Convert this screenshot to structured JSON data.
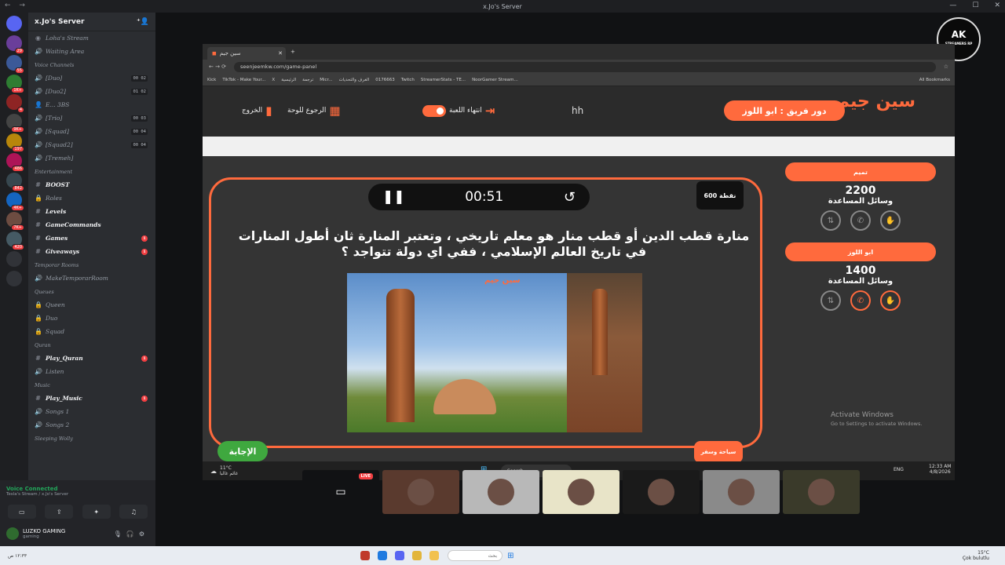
{
  "window": {
    "title": "x.Jo's Server"
  },
  "server": {
    "name": "x.Jo's Server",
    "sidebar_badges": [
      "29",
      "55",
      "1K+",
      "4",
      "9K+",
      "197",
      "486",
      "842",
      "4K+",
      "7K+",
      "420"
    ]
  },
  "channels": {
    "top": [
      {
        "icon": "stream",
        "label": "Loha's Stream"
      },
      {
        "icon": "speaker",
        "label": "Waiting Area"
      }
    ],
    "voice_category": "Voice Channels",
    "voice": [
      {
        "label": "[Duo]",
        "count": "00 02"
      },
      {
        "label": "[Duo2]",
        "count": "01 02"
      },
      {
        "label": "E... 3BS",
        "count": ""
      },
      {
        "label": "[Trio]",
        "count": "00 03"
      },
      {
        "label": "[Squad]",
        "count": "00 04"
      },
      {
        "label": "[Squad2]",
        "count": "00 04"
      },
      {
        "label": "[Tremeh]",
        "count": ""
      }
    ],
    "ent_category": "Entertainment",
    "entertainment": [
      {
        "label": "BOOST",
        "bold": true,
        "mention": ""
      },
      {
        "label": "Roles",
        "bold": false,
        "mention": ""
      },
      {
        "label": "Levels",
        "bold": true,
        "mention": ""
      },
      {
        "label": "GameCommands",
        "bold": true,
        "mention": ""
      },
      {
        "label": "Games",
        "bold": true,
        "mention": "1"
      },
      {
        "label": "Giveaways",
        "bold": true,
        "mention": "1"
      }
    ],
    "temp_category": "Temporar Rooms",
    "temp": [
      {
        "label": "MakeTemporarRoom"
      }
    ],
    "queue_category": "Queues",
    "queues": [
      {
        "label": "Queen"
      },
      {
        "label": "Duo"
      },
      {
        "label": "Squad"
      }
    ],
    "quran_category": "Quran",
    "quran": [
      {
        "label": "Play_Quran",
        "mention": "1"
      },
      {
        "label": "Listen",
        "mention": ""
      }
    ],
    "music_category": "Music",
    "music": [
      {
        "label": "Play_Music",
        "mention": "1"
      },
      {
        "label": "Songs 1",
        "mention": ""
      },
      {
        "label": "Songs 2",
        "mention": ""
      }
    ],
    "sleep_category": "Sleeping Wolly"
  },
  "voice_panel": {
    "status": "Voice Connected",
    "sub": "Tesla's Stream / x.Jo's Server",
    "user": "LUZKO GAMING",
    "user_status": "gaming"
  },
  "browser": {
    "tab": "سين جيم",
    "url": "seenjeemkw.com/game-panel",
    "bookmarks": [
      "Kick",
      "TikTok - Make Your...",
      "X",
      "الرئيسية",
      "ترجمة",
      "Micr...",
      "الغرف والتحديات",
      "0176663",
      "Twitch",
      "StreamerStats - TE...",
      "NoorGamer Stream...",
      "All Bookmarks"
    ]
  },
  "game": {
    "logo": "سين جيم",
    "turn": "دور فريق : ابو اللوز",
    "center_text": "hh",
    "controls": {
      "end_game": "انتهاء اللعبة",
      "back_to_board": "الرجوع للوحة",
      "exit": "الخروج"
    },
    "timer": "00:51",
    "points": "600 نقطة",
    "question": "منارة قطب الدين أو قطب منار هو معلم تاريخي ، وتعتبر المنارة ثان أطول المنارات في تاريخ العالم الإسلامي ، ففي اي دولة تتواجد ؟",
    "category_tag": "سياحة وسفر",
    "answer_button": "الإجابة",
    "image_watermark": "سين جيم",
    "teams": [
      {
        "name": "تميم",
        "score": "2200",
        "help_label": "وسائل المساعدة"
      },
      {
        "name": "ابو اللوز",
        "score": "1400",
        "help_label": "وسائل المساعدة"
      }
    ]
  },
  "activate": {
    "title": "Activate Windows",
    "sub": "Go to Settings to activate Windows."
  },
  "inner_taskbar": {
    "weather": "11°C",
    "weather_sub": "غائم غالبا",
    "search": "Search",
    "lang": "ENG",
    "time": "12:33 AM",
    "date": "4/8/2026"
  },
  "thumbnails": {
    "live_label": "LIVE",
    "badge": "AK",
    "badge_sub": "STREAMERS RP"
  },
  "os_taskbar": {
    "search": "بحث",
    "weather": "15°C",
    "weather_sub": "Çok bulutlu"
  },
  "colors": {
    "accent": "#ff6a3d",
    "discord_bg": "#2b2d31",
    "answer": "#3fa83f"
  }
}
